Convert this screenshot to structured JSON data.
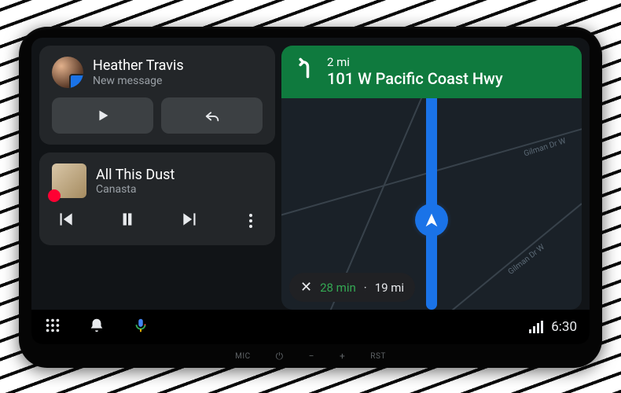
{
  "notification": {
    "sender_name": "Heather Travis",
    "status_text": "New message",
    "app_badge": "messages-app"
  },
  "media": {
    "track_title": "All This Dust",
    "artist": "Canasta",
    "source_badge": "youtube-music"
  },
  "navigation": {
    "maneuver": "turn-left",
    "distance": "2 mi",
    "road": "101 W Pacific Coast Hwy",
    "nearby_street": "Gilman Dr W",
    "eta_minutes": "28 min",
    "eta_distance": "19 mi"
  },
  "status_bar": {
    "time": "6:30"
  },
  "hardware_labels": {
    "mic": "MIC",
    "power": "⏻",
    "vol_down": "−",
    "vol_up": "+",
    "reset": "RST"
  },
  "colors": {
    "accent": "#1a73e8",
    "nav_banner": "#0f7a3e",
    "eta_time": "#34a853"
  }
}
